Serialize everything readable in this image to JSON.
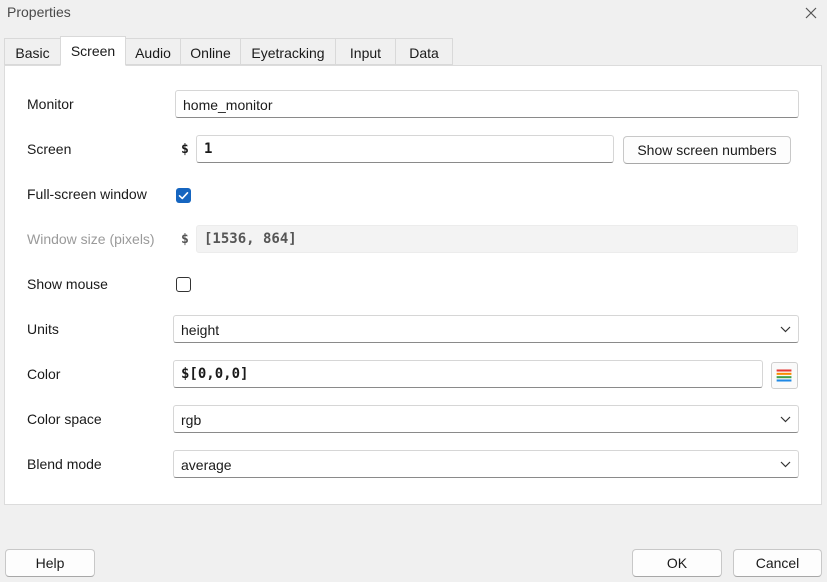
{
  "window": {
    "title": "Properties",
    "close_icon": "close-icon"
  },
  "tabs": [
    {
      "label": "Basic",
      "active": false
    },
    {
      "label": "Screen",
      "active": true
    },
    {
      "label": "Audio",
      "active": false
    },
    {
      "label": "Online",
      "active": false
    },
    {
      "label": "Eyetracking",
      "active": false
    },
    {
      "label": "Input",
      "active": false
    },
    {
      "label": "Data",
      "active": false
    }
  ],
  "form": {
    "monitor": {
      "label": "Monitor",
      "value": "home_monitor"
    },
    "screen": {
      "label": "Screen",
      "prefix": "$",
      "value": "1",
      "button": "Show screen numbers"
    },
    "fullscreen": {
      "label": "Full-screen window",
      "checked": true
    },
    "window_size": {
      "label": "Window size (pixels)",
      "prefix": "$",
      "value": "[1536, 864]",
      "disabled": true
    },
    "show_mouse": {
      "label": "Show mouse",
      "checked": false
    },
    "units": {
      "label": "Units",
      "value": "height"
    },
    "color": {
      "label": "Color",
      "value": "$[0,0,0]",
      "picker_icon": "color-picker-icon"
    },
    "color_space": {
      "label": "Color space",
      "value": "rgb"
    },
    "blend_mode": {
      "label": "Blend mode",
      "value": "average"
    }
  },
  "footer": {
    "help": "Help",
    "ok": "OK",
    "cancel": "Cancel"
  },
  "colors": {
    "accent": "#1565c0",
    "panel_bg": "#ffffff",
    "window_bg": "#f0f0f0"
  }
}
